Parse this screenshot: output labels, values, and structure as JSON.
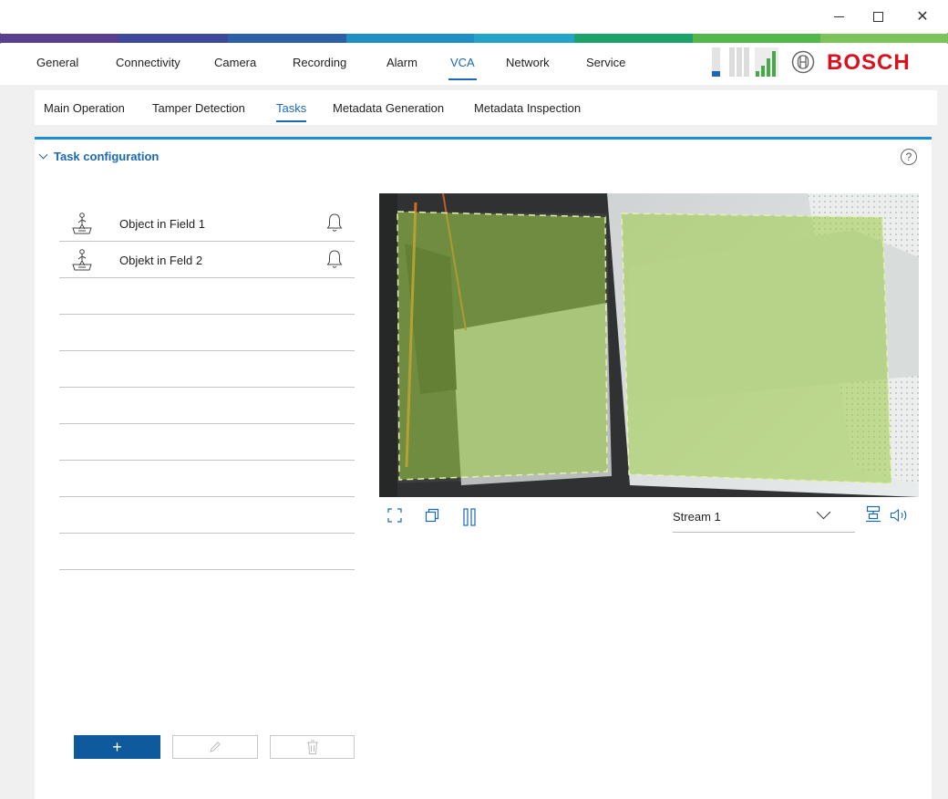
{
  "window": {
    "controls": {
      "minimize": "–",
      "maximize": "□",
      "close": "✕"
    }
  },
  "colors": {
    "accent": "#1b69b5",
    "panel_border": "#1b8fd6",
    "add_button": "#0f5a9c",
    "brand_red": "#d9101d",
    "rainbow": [
      "#5a3f8f",
      "#3d4a9c",
      "#2b5fa8",
      "#1e8fc5",
      "#21a4c7",
      "#1aa46a",
      "#52b84a",
      "#7cc35a"
    ]
  },
  "main_nav": {
    "items": [
      {
        "label": "General"
      },
      {
        "label": "Connectivity"
      },
      {
        "label": "Camera"
      },
      {
        "label": "Recording"
      },
      {
        "label": "Alarm"
      },
      {
        "label": "VCA"
      },
      {
        "label": "Network"
      },
      {
        "label": "Service"
      }
    ],
    "active": "VCA"
  },
  "brand": {
    "name": "BOSCH",
    "emblem": "bosch-armature-icon"
  },
  "status": {
    "icons": [
      "cpu-load-icon",
      "recording-status-icon",
      "signal-strength-icon"
    ]
  },
  "sub_nav": {
    "items": [
      {
        "label": "Main Operation"
      },
      {
        "label": "Tamper Detection"
      },
      {
        "label": "Tasks"
      },
      {
        "label": "Metadata Generation"
      },
      {
        "label": "Metadata Inspection"
      }
    ],
    "active": "Tasks"
  },
  "panel": {
    "title": "Task configuration",
    "help": "?"
  },
  "tasks": [
    {
      "label": "Object in Field 1",
      "icon": "person-in-field-icon",
      "alarm_icon": "bell-icon"
    },
    {
      "label": "Objekt in Feld 2",
      "icon": "person-in-field-icon",
      "alarm_icon": "bell-icon"
    }
  ],
  "empty_rows": 8,
  "buttons": {
    "add": "+",
    "edit_icon": "pencil-icon",
    "delete_icon": "trash-icon"
  },
  "video": {
    "stream": "Stream 1",
    "controls": [
      "fullscreen-icon",
      "copy-snapshot-icon",
      "pause-icon",
      "layout-icon",
      "audio-icon"
    ]
  }
}
